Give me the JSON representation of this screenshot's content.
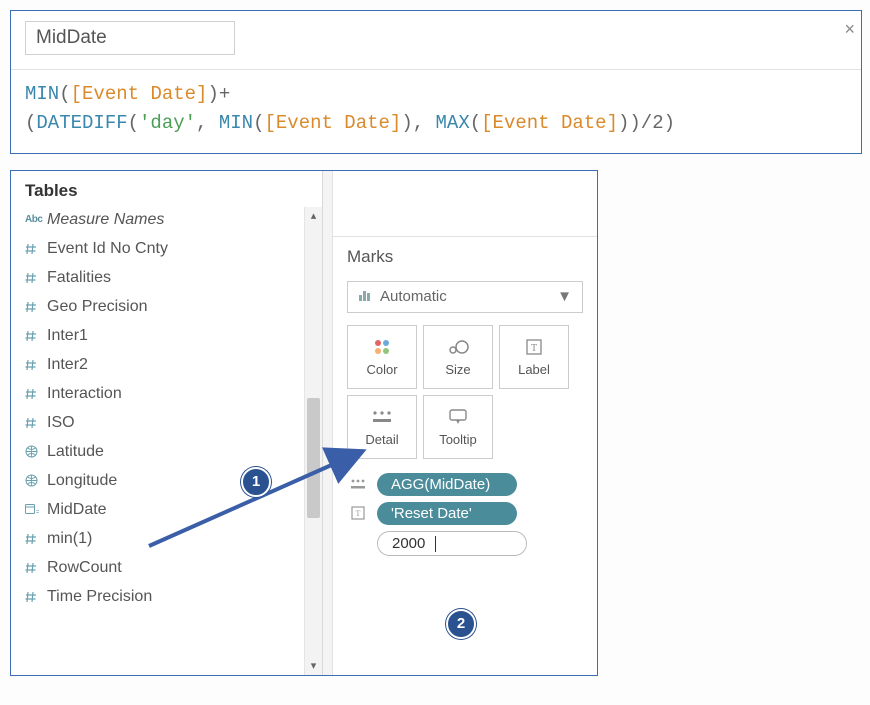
{
  "calc": {
    "name": "MidDate",
    "tokens": [
      {
        "t": "fn",
        "v": "MIN"
      },
      {
        "t": "punc",
        "v": "("
      },
      {
        "t": "fld",
        "v": "[Event Date]"
      },
      {
        "t": "punc",
        "v": ")+"
      },
      {
        "t": "br"
      },
      {
        "t": "punc",
        "v": "("
      },
      {
        "t": "fn",
        "v": "DATEDIFF"
      },
      {
        "t": "punc",
        "v": "("
      },
      {
        "t": "str",
        "v": "'day'"
      },
      {
        "t": "punc",
        "v": ", "
      },
      {
        "t": "fn",
        "v": "MIN"
      },
      {
        "t": "punc",
        "v": "("
      },
      {
        "t": "fld",
        "v": "[Event Date]"
      },
      {
        "t": "punc",
        "v": "), "
      },
      {
        "t": "fn",
        "v": "MAX"
      },
      {
        "t": "punc",
        "v": "("
      },
      {
        "t": "fld",
        "v": "[Event Date]"
      },
      {
        "t": "punc",
        "v": "))/"
      },
      {
        "t": "num",
        "v": "2"
      },
      {
        "t": "punc",
        "v": ")"
      }
    ]
  },
  "data_pane": {
    "header": "Tables",
    "fields": [
      {
        "icon": "abc",
        "label": "Measure Names",
        "italic": true
      },
      {
        "icon": "hash",
        "label": "Event Id No Cnty"
      },
      {
        "icon": "hash",
        "label": "Fatalities"
      },
      {
        "icon": "hash",
        "label": "Geo Precision"
      },
      {
        "icon": "hash",
        "label": "Inter1"
      },
      {
        "icon": "hash",
        "label": "Inter2"
      },
      {
        "icon": "hash",
        "label": "Interaction"
      },
      {
        "icon": "hash",
        "label": "ISO"
      },
      {
        "icon": "globe",
        "label": "Latitude"
      },
      {
        "icon": "globe",
        "label": "Longitude"
      },
      {
        "icon": "datecalc",
        "label": "MidDate"
      },
      {
        "icon": "hash",
        "label": "min(1)"
      },
      {
        "icon": "hash",
        "label": "RowCount"
      },
      {
        "icon": "hash",
        "label": "Time Precision"
      }
    ]
  },
  "marks": {
    "title": "Marks",
    "type_label": "Automatic",
    "buttons": {
      "color": "Color",
      "size": "Size",
      "label": "Label",
      "detail": "Detail",
      "tooltip": "Tooltip"
    },
    "shelves": [
      {
        "icon": "detail",
        "pill": "AGG(MidDate)"
      },
      {
        "icon": "label",
        "pill": "'Reset Date'"
      }
    ],
    "input_value": "2000"
  },
  "callouts": {
    "c1": "1",
    "c2": "2"
  }
}
